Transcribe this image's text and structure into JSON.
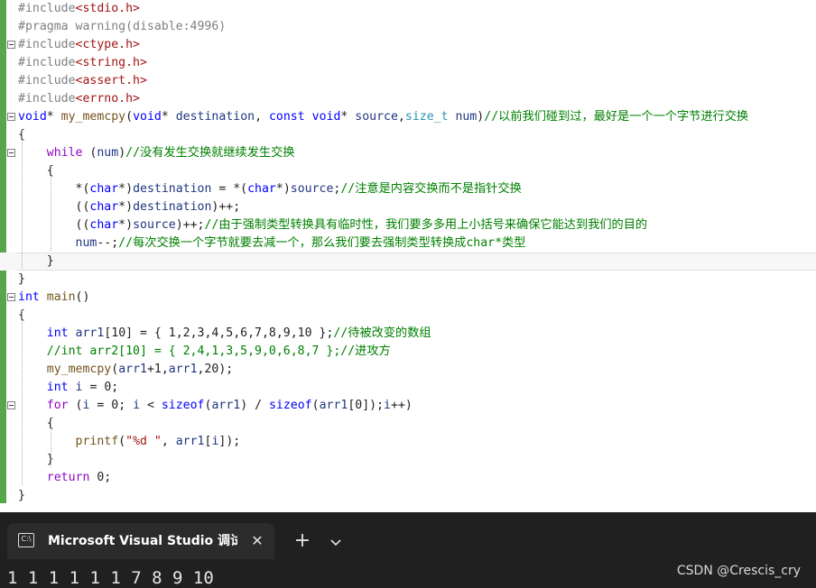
{
  "editor": {
    "lines": [
      [
        {
          "t": "#include",
          "c": "pp"
        },
        {
          "t": "<stdio.h>",
          "c": "s"
        }
      ],
      [
        {
          "t": "#pragma warning(disable:4996)",
          "c": "pp"
        }
      ],
      [
        {
          "t": "#include",
          "c": "pp"
        },
        {
          "t": "<ctype.h>",
          "c": "s"
        }
      ],
      [
        {
          "t": "#include",
          "c": "pp"
        },
        {
          "t": "<string.h>",
          "c": "s"
        }
      ],
      [
        {
          "t": "#include",
          "c": "pp"
        },
        {
          "t": "<assert.h>",
          "c": "s"
        }
      ],
      [
        {
          "t": "#include",
          "c": "pp"
        },
        {
          "t": "<errno.h>",
          "c": "s"
        }
      ],
      [
        {
          "t": "void",
          "c": "k"
        },
        {
          "t": "* ",
          "c": "n"
        },
        {
          "t": "my_memcpy",
          "c": "f"
        },
        {
          "t": "(",
          "c": "n"
        },
        {
          "t": "void",
          "c": "k"
        },
        {
          "t": "* ",
          "c": "n"
        },
        {
          "t": "destination",
          "c": "v"
        },
        {
          "t": ", ",
          "c": "n"
        },
        {
          "t": "const",
          "c": "k"
        },
        {
          "t": " ",
          "c": "n"
        },
        {
          "t": "void",
          "c": "k"
        },
        {
          "t": "* ",
          "c": "n"
        },
        {
          "t": "source",
          "c": "v"
        },
        {
          "t": ",",
          "c": "n"
        },
        {
          "t": "size_t",
          "c": "t"
        },
        {
          "t": " ",
          "c": "n"
        },
        {
          "t": "num",
          "c": "v"
        },
        {
          "t": ")",
          "c": "n"
        },
        {
          "t": "//以前我们碰到过，最好是一个一个字节进行交换",
          "c": "c"
        }
      ],
      [
        {
          "t": "{",
          "c": "n"
        }
      ],
      [
        {
          "t": "    ",
          "c": "n"
        },
        {
          "t": "while",
          "c": "ctl"
        },
        {
          "t": " (",
          "c": "n"
        },
        {
          "t": "num",
          "c": "v"
        },
        {
          "t": ")",
          "c": "n"
        },
        {
          "t": "//没有发生交换就继续发生交换",
          "c": "c"
        }
      ],
      [
        {
          "t": "    {",
          "c": "n"
        }
      ],
      [
        {
          "t": "        *(",
          "c": "n"
        },
        {
          "t": "char",
          "c": "k"
        },
        {
          "t": "*)",
          "c": "n"
        },
        {
          "t": "destination",
          "c": "v"
        },
        {
          "t": " = *(",
          "c": "n"
        },
        {
          "t": "char",
          "c": "k"
        },
        {
          "t": "*)",
          "c": "n"
        },
        {
          "t": "source",
          "c": "v"
        },
        {
          "t": ";",
          "c": "n"
        },
        {
          "t": "//注意是内容交换而不是指针交换",
          "c": "c"
        }
      ],
      [
        {
          "t": "        ((",
          "c": "n"
        },
        {
          "t": "char",
          "c": "k"
        },
        {
          "t": "*)",
          "c": "n"
        },
        {
          "t": "destination",
          "c": "v"
        },
        {
          "t": ")++;",
          "c": "n"
        }
      ],
      [
        {
          "t": "        ((",
          "c": "n"
        },
        {
          "t": "char",
          "c": "k"
        },
        {
          "t": "*)",
          "c": "n"
        },
        {
          "t": "source",
          "c": "v"
        },
        {
          "t": ")++;",
          "c": "n"
        },
        {
          "t": "//由于强制类型转换具有临时性，我们要多多用上小括号来确保它能达到我们的目的",
          "c": "c"
        }
      ],
      [
        {
          "t": "        ",
          "c": "n"
        },
        {
          "t": "num",
          "c": "v"
        },
        {
          "t": "--;",
          "c": "n"
        },
        {
          "t": "//每次交换一个字节就要去减一个，那么我们要去强制类型转换成char*类型",
          "c": "c"
        }
      ],
      [
        {
          "t": "    }",
          "c": "n"
        }
      ],
      [
        {
          "t": "}",
          "c": "n"
        }
      ],
      [
        {
          "t": "int",
          "c": "k"
        },
        {
          "t": " ",
          "c": "n"
        },
        {
          "t": "main",
          "c": "f"
        },
        {
          "t": "()",
          "c": "n"
        }
      ],
      [
        {
          "t": "{",
          "c": "n"
        }
      ],
      [
        {
          "t": "    ",
          "c": "n"
        },
        {
          "t": "int",
          "c": "k"
        },
        {
          "t": " ",
          "c": "n"
        },
        {
          "t": "arr1",
          "c": "v"
        },
        {
          "t": "[10] = { 1,2,3,4,5,6,7,8,9,10 };",
          "c": "n"
        },
        {
          "t": "//待被改变的数组",
          "c": "c"
        }
      ],
      [
        {
          "t": "    ",
          "c": "n"
        },
        {
          "t": "//int arr2[10] = { 2,4,1,3,5,9,0,6,8,7 };//进攻方",
          "c": "c"
        }
      ],
      [
        {
          "t": "    ",
          "c": "n"
        },
        {
          "t": "my_memcpy",
          "c": "f"
        },
        {
          "t": "(",
          "c": "n"
        },
        {
          "t": "arr1",
          "c": "v"
        },
        {
          "t": "+1,",
          "c": "n"
        },
        {
          "t": "arr1",
          "c": "v"
        },
        {
          "t": ",20);",
          "c": "n"
        }
      ],
      [
        {
          "t": "    ",
          "c": "n"
        },
        {
          "t": "int",
          "c": "k"
        },
        {
          "t": " ",
          "c": "n"
        },
        {
          "t": "i",
          "c": "v"
        },
        {
          "t": " = 0;",
          "c": "n"
        }
      ],
      [
        {
          "t": "    ",
          "c": "n"
        },
        {
          "t": "for",
          "c": "ctl"
        },
        {
          "t": " (",
          "c": "n"
        },
        {
          "t": "i",
          "c": "v"
        },
        {
          "t": " = 0; ",
          "c": "n"
        },
        {
          "t": "i",
          "c": "v"
        },
        {
          "t": " < ",
          "c": "n"
        },
        {
          "t": "sizeof",
          "c": "k"
        },
        {
          "t": "(",
          "c": "n"
        },
        {
          "t": "arr1",
          "c": "v"
        },
        {
          "t": ") / ",
          "c": "n"
        },
        {
          "t": "sizeof",
          "c": "k"
        },
        {
          "t": "(",
          "c": "n"
        },
        {
          "t": "arr1",
          "c": "v"
        },
        {
          "t": "[0]);",
          "c": "n"
        },
        {
          "t": "i",
          "c": "v"
        },
        {
          "t": "++)",
          "c": "n"
        }
      ],
      [
        {
          "t": "    {",
          "c": "n"
        }
      ],
      [
        {
          "t": "        ",
          "c": "n"
        },
        {
          "t": "printf",
          "c": "f"
        },
        {
          "t": "(",
          "c": "n"
        },
        {
          "t": "\"%d \"",
          "c": "s"
        },
        {
          "t": ", ",
          "c": "n"
        },
        {
          "t": "arr1",
          "c": "v"
        },
        {
          "t": "[",
          "c": "n"
        },
        {
          "t": "i",
          "c": "v"
        },
        {
          "t": "]);",
          "c": "n"
        }
      ],
      [
        {
          "t": "    }",
          "c": "n"
        }
      ],
      [
        {
          "t": "    ",
          "c": "n"
        },
        {
          "t": "return",
          "c": "ctl"
        },
        {
          "t": " 0;",
          "c": "n"
        }
      ],
      [
        {
          "t": "}",
          "c": "n"
        }
      ]
    ]
  },
  "terminal": {
    "tab_icon_text": "C:\\",
    "tab_title": "Microsoft Visual Studio 调试控制台",
    "close_glyph": "✕",
    "new_tab_glyph": "+",
    "dropdown_icon": "chevron-down-icon",
    "output": "1 1 1 1 1 1 7 8 9 10"
  },
  "watermark": "CSDN @Crescis_cry",
  "colors": {
    "keyword": "#0000ff",
    "type": "#2b91af",
    "function": "#74531f",
    "variable": "#1f377f",
    "comment": "#008000",
    "string": "#a31515",
    "preprocessor": "#808080",
    "control": "#8f08c4",
    "change_bar": "#57a64a",
    "terminal_bg": "#202020"
  }
}
